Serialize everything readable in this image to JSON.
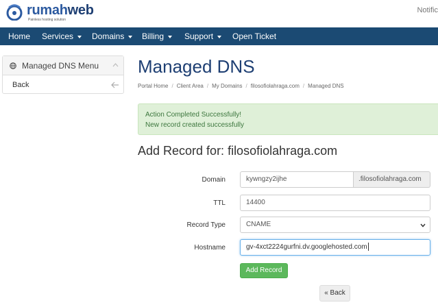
{
  "brand": {
    "name_part1": "rumah",
    "name_part2": "web",
    "tagline": "Painless hosting solution"
  },
  "header": {
    "notifications_label": "Notific"
  },
  "nav": {
    "items": [
      {
        "label": "Home",
        "dropdown": false
      },
      {
        "label": "Services",
        "dropdown": true
      },
      {
        "label": "Domains",
        "dropdown": true
      },
      {
        "label": "Billing",
        "dropdown": true
      },
      {
        "label": "Support",
        "dropdown": true
      },
      {
        "label": "Open Ticket",
        "dropdown": false
      }
    ]
  },
  "sidebar": {
    "title": "Managed DNS Menu",
    "title_icon": "globe-icon",
    "items": [
      {
        "label": "Back",
        "icon": "arrow-left-icon"
      }
    ]
  },
  "page": {
    "title": "Managed DNS",
    "breadcrumb": [
      "Portal Home",
      "Client Area",
      "My Domains",
      "filosofiolahraga.com",
      "Managed DNS"
    ]
  },
  "alert": {
    "title": "Action Completed Successfully!",
    "message": "New record created successfully",
    "color": "#dff0d8"
  },
  "form": {
    "title": "Add Record for: filosofiolahraga.com",
    "domain_label": "Domain",
    "domain_value": "kywngzy2ijhe",
    "domain_suffix": ".filosofiolahraga.com",
    "ttl_label": "TTL",
    "ttl_value": "14400",
    "record_type_label": "Record Type",
    "record_type_value": "CNAME",
    "hostname_label": "Hostname",
    "hostname_value": "gv-4xct2224gurfni.dv.googlehosted.com",
    "submit_label": "Add Record",
    "back_label": "« Back"
  },
  "colors": {
    "navbar": "#1b4a73",
    "brand": "#2c5aa0",
    "title": "#1e3f73",
    "success_button": "#5cb85c"
  }
}
